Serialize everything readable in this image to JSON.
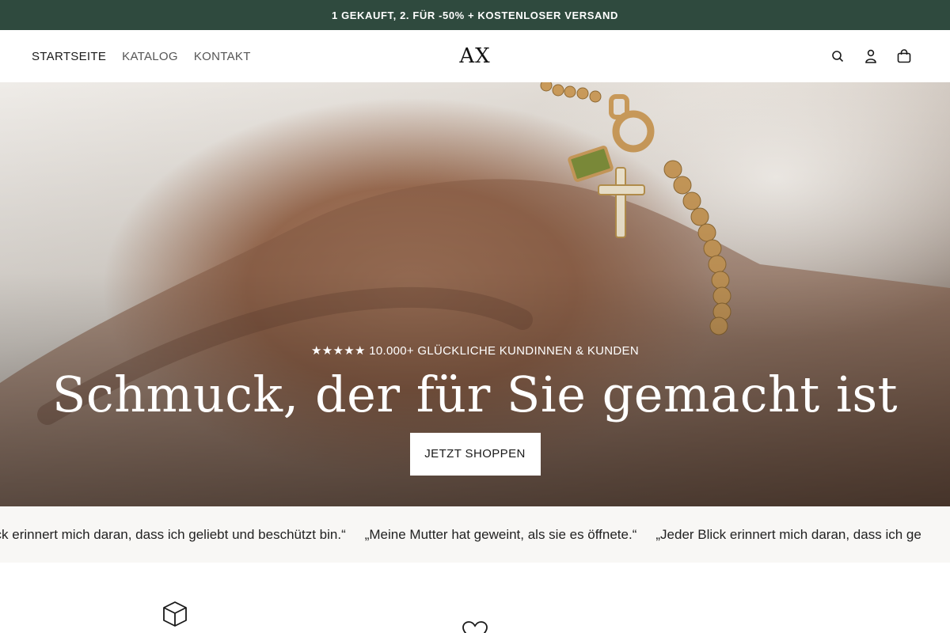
{
  "announcement": "1 GEKAUFT, 2. FÜR -50% + KOSTENLOSER VERSAND",
  "header": {
    "nav": [
      "STARTSEITE",
      "KATALOG",
      "KONTAKT"
    ],
    "logo": "AX",
    "icons": [
      "search-icon",
      "account-icon",
      "cart-icon"
    ]
  },
  "hero": {
    "rating": "★★★★★ 10.000+ GLÜCKLICHE KUNDINNEN & KUNDEN",
    "headline": "Schmuck, der für Sie gemacht ist",
    "cta": "JETZT SHOPPEN"
  },
  "marquee": {
    "quotes": [
      "lick erinnert mich daran, dass ich geliebt und beschützt bin.“",
      "„Meine Mutter hat geweint, als sie es öffnete.“",
      "„Jeder Blick erinnert mich daran, dass ich ge"
    ]
  },
  "features": {
    "icons": [
      "box-icon",
      "heart-icon"
    ]
  },
  "colors": {
    "announcement_bg": "#2f4a3e",
    "marquee_bg": "#f8f7f5"
  }
}
